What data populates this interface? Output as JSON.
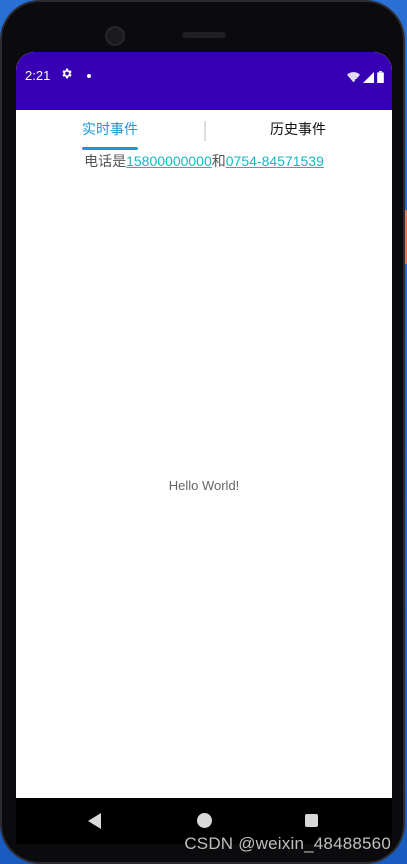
{
  "status_bar": {
    "time": "2:21"
  },
  "tabs": [
    {
      "label": "实时事件",
      "active": true
    },
    {
      "label": "历史事件",
      "active": false
    }
  ],
  "contact": {
    "prefix": "电话是",
    "mobile": "15800000000",
    "connector": "和",
    "landline": "0754-84571539"
  },
  "main": {
    "message": "Hello World!"
  },
  "watermark": "CSDN @weixin_48488560",
  "colors": {
    "status_bar": "#3700b3",
    "tab_active": "#1e96d8",
    "link": "#14b9c4"
  }
}
